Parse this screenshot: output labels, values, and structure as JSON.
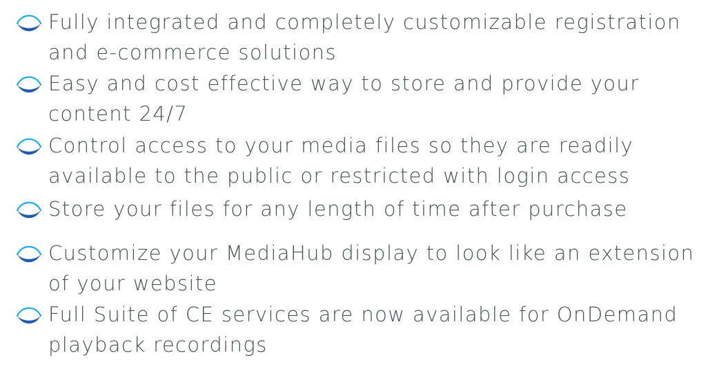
{
  "colors": {
    "text": "#4b5158",
    "icon_top": "#1daee9",
    "icon_bottom": "#1f5bb0"
  },
  "features": {
    "icon": "wave-arc-icon",
    "items": [
      {
        "text": "Fully integrated and completely customizable registration and e-commerce solutions"
      },
      {
        "text": "Easy and cost effective way to store and provide your content 24/7"
      },
      {
        "text": "Control access to your media files so they are readily available to the public or restricted with login access"
      },
      {
        "text": "Store your files for any length of time after purchase"
      },
      {
        "text": "Customize your MediaHub display to look like an extension of your website"
      },
      {
        "text": "Full Suite of CE services are now available for OnDemand playback recordings"
      }
    ]
  }
}
